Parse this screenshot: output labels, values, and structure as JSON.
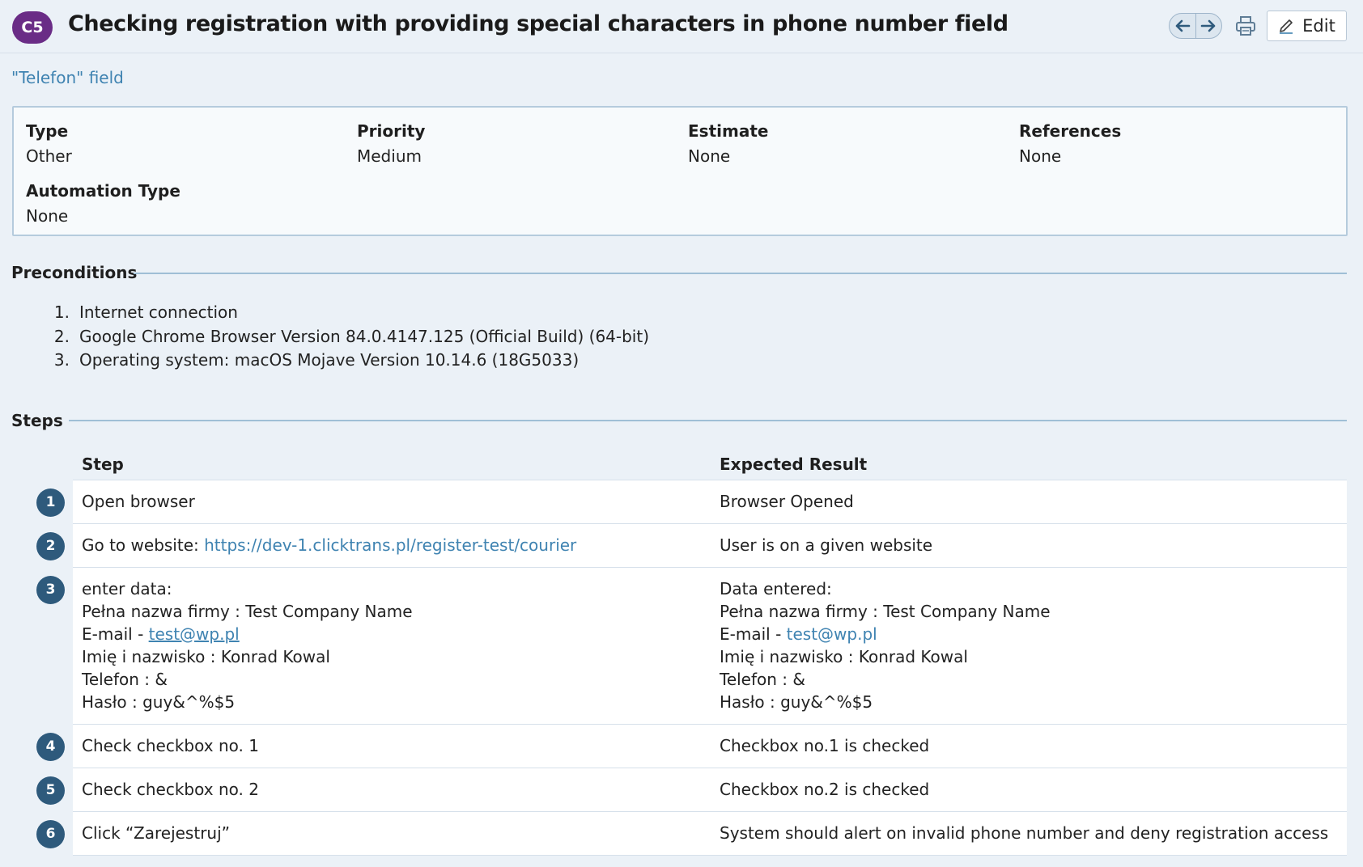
{
  "header": {
    "badge": "C5",
    "title": "Checking registration with providing special characters in phone number field",
    "edit_label": "Edit"
  },
  "section_link": "\"Telefon\" field",
  "properties": [
    {
      "label": "Type",
      "value": "Other"
    },
    {
      "label": "Priority",
      "value": "Medium"
    },
    {
      "label": "Estimate",
      "value": "None"
    },
    {
      "label": "References",
      "value": "None"
    },
    {
      "label": "Automation Type",
      "value": "None"
    }
  ],
  "preconditions": {
    "heading": "Preconditions",
    "items": [
      {
        "num": "1.",
        "text": "Internet connection"
      },
      {
        "num": "2.",
        "text": "Google Chrome Browser Version 84.0.4147.125 (Official Build) (64-bit)"
      },
      {
        "num": "3.",
        "text": "Operating system: macOS Mojave Version 10.14.6 (18G5033)"
      }
    ]
  },
  "steps": {
    "heading": "Steps",
    "col_step": "Step",
    "col_expected": "Expected Result",
    "rows": [
      {
        "num": "1",
        "step": "Open browser",
        "expected": "Browser Opened"
      },
      {
        "num": "2",
        "step_prefix": "Go to website: ",
        "step_link": "https://dev-1.clicktrans.pl/register-test/courier",
        "expected": "User is on a given website"
      },
      {
        "num": "3",
        "step_lines": [
          "enter data:",
          "Pełna nazwa firmy : Test Company Name",
          "E-mail - ",
          "Imię i nazwisko : Konrad Kowal",
          "Telefon : &",
          "Hasło : guy&^%$5"
        ],
        "step_email": "test@wp.pl",
        "expected_lines": [
          "Data entered:",
          "Pełna nazwa firmy : Test Company Name",
          "E-mail - ",
          "Imię i nazwisko : Konrad Kowal",
          "Telefon : &",
          "Hasło : guy&^%$5"
        ],
        "expected_email": "test@wp.pl"
      },
      {
        "num": "4",
        "step": "Check checkbox no. 1",
        "expected": "Checkbox no.1 is checked"
      },
      {
        "num": "5",
        "step": "Check checkbox no. 2",
        "expected": "Checkbox no.2 is checked"
      },
      {
        "num": "6",
        "step": "Click “Zarejestruj”",
        "expected": "System should alert on invalid phone number and deny registration access"
      }
    ]
  },
  "colors": {
    "badge": "#6a2c86",
    "link": "#3f83b1",
    "step_circle": "#2e5a7c",
    "background": "#ebf1f7"
  }
}
